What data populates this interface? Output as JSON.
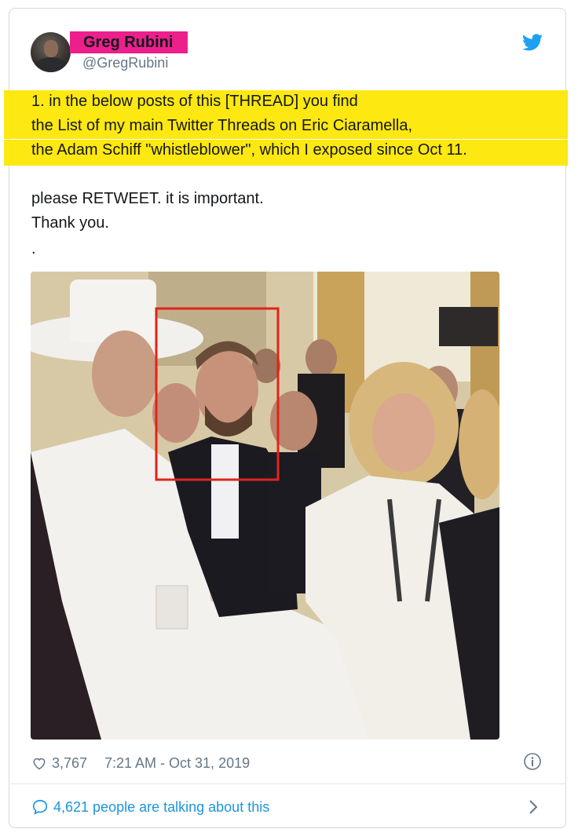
{
  "tweet": {
    "author_name": "Greg Rubini",
    "author_handle": "@GregRubini",
    "lines": [
      "1. in the below posts of this [THREAD] you find",
      "the List of my main Twitter Threads on Eric Ciaramella,",
      "the Adam Schiff \"whistleblower\", which I exposed since Oct 11.",
      "please RETWEET. it is important.",
      "Thank you.",
      "."
    ],
    "highlight_color": "#fde811",
    "name_highlight_color": "#ec1f8c",
    "likes": "3,767",
    "timestamp": "7:21 AM - Oct 31, 2019",
    "talking": "4,621 people are talking about this"
  },
  "icons": {
    "brand": "twitter-bird-icon",
    "likes": "heart-icon",
    "info": "info-icon",
    "talking": "speech-bubble-icon",
    "more": "chevron-right-icon"
  },
  "colors": {
    "twitter_blue": "#1da1f2",
    "link_blue": "#1b95e0",
    "muted": "#657786",
    "border": "#cfd9de"
  }
}
